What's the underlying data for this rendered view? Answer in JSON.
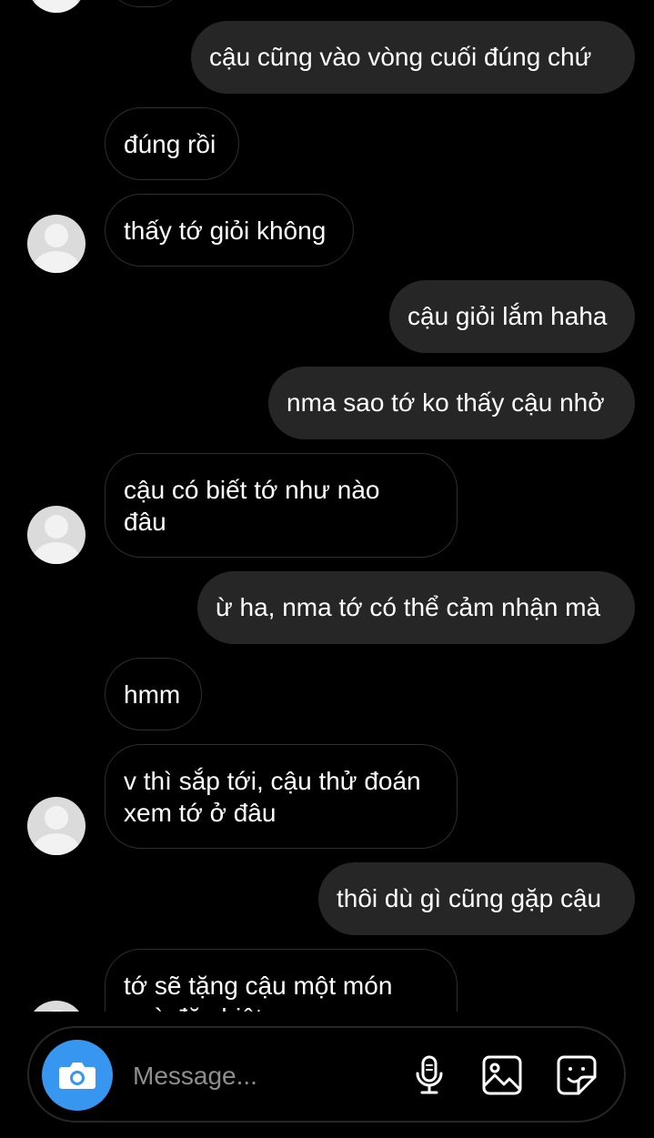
{
  "messages": [
    {
      "from": "other",
      "text": "",
      "avatar": false
    },
    {
      "from": "me",
      "text": "cậu cũng vào vòng cuối đúng chứ"
    },
    {
      "from": "other",
      "text": "đúng rồi",
      "avatar": false
    },
    {
      "from": "other",
      "text": "thấy tớ giỏi không",
      "avatar": true
    },
    {
      "from": "me",
      "text": "cậu giỏi lắm haha"
    },
    {
      "from": "me",
      "text": "nma sao tớ ko thấy cậu nhở"
    },
    {
      "from": "other",
      "text": "cậu có biết tớ như nào\nđâu",
      "avatar": true
    },
    {
      "from": "me",
      "text": "ừ ha, nma tớ có thể cảm nhận mà"
    },
    {
      "from": "other",
      "text": "hmm",
      "avatar": false
    },
    {
      "from": "other",
      "text": "v thì sắp tới, cậu thử đoán\nxem tớ ở đâu",
      "avatar": true
    },
    {
      "from": "me",
      "text": "thôi dù gì cũng gặp cậu"
    },
    {
      "from": "other",
      "text": "tớ sẽ tặng cậu một món\nquà đặc biệt",
      "avatar": true
    }
  ],
  "composer": {
    "placeholder": "Message...",
    "icons": [
      "camera-icon",
      "microphone-icon",
      "gallery-icon",
      "sticker-icon"
    ],
    "camera_color": "#3797f0"
  }
}
